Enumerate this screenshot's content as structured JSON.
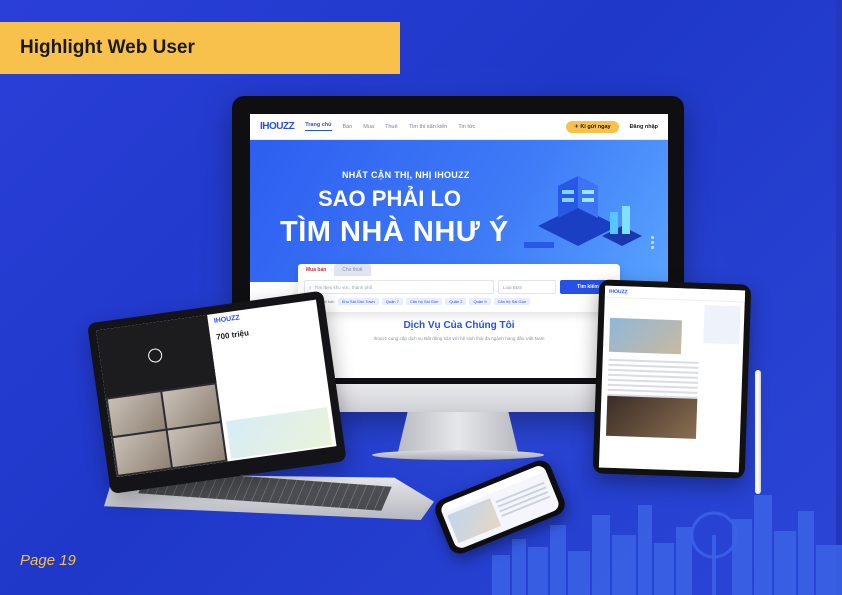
{
  "header": {
    "title": "Highlight Web User"
  },
  "footer": {
    "page_label": "Page 19"
  },
  "website": {
    "logo": "IHOUZZ",
    "nav": [
      "Trang chủ",
      "Bán",
      "Mua",
      "Thuê",
      "Tìm thi sản kiến",
      "Tin tức"
    ],
    "cta": "Kí gửi ngay",
    "login": "Đăng nhập",
    "hero_sub": "NHẤT CẬN THỊ, NHỊ IHOUZZ",
    "hero_line1": "SAO PHẢI LO",
    "hero_line2": "TÌM NHÀ NHƯ Ý",
    "search_tabs": [
      "Mua bán",
      "Cho thuê"
    ],
    "search_placeholder": "Tìm theo khu vực, thành phố",
    "search_type": "Loại BĐS",
    "search_button": "Tìm kiếm",
    "chips_label": "Tìm kiếm nổi bật:",
    "chips": [
      "Khu Sài Gòn Town",
      "Quận 7",
      "Căn hộ Sài Gòn",
      "Quận 2",
      "Quận 9",
      "Căn hộ Sài Gòn"
    ],
    "services_title": "Dịch Vụ Của Chúng Tôi",
    "services_sub": "Ihouzz cung cấp dịch vụ Bất động sản với hệ sinh thái đa ngành hàng đầu Việt Nam"
  },
  "laptop": {
    "logo": "IHOUZZ",
    "price": "700 triệu"
  },
  "tablet": {
    "logo": "IHOUZZ"
  },
  "colors": {
    "background": "#2a3fd8",
    "accent": "#f7c14b",
    "brand": "#2750e8"
  }
}
